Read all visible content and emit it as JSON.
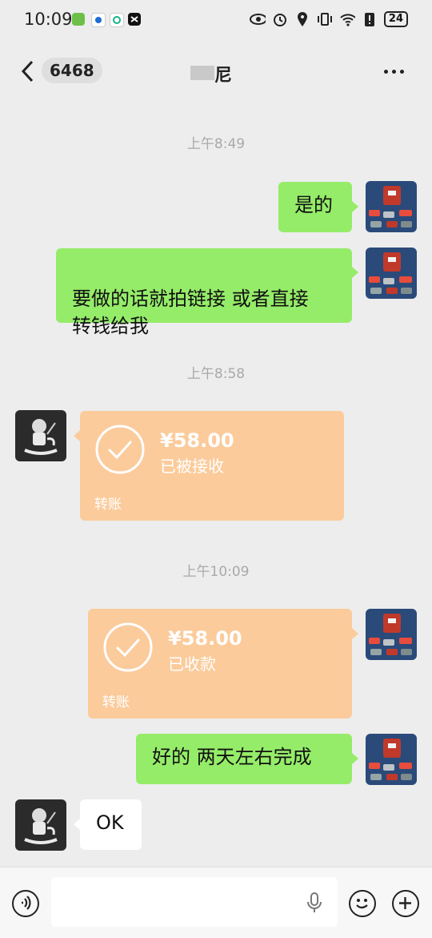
{
  "status_bar": {
    "time": "10:09",
    "battery": "24",
    "app_icons": [
      "green-app-icon",
      "blue-app-icon",
      "teal-app-icon",
      "capcut-icon"
    ],
    "system_icons": [
      "eye-icon",
      "alarm-icon",
      "location-icon",
      "vibrate-icon",
      "wifi-icon",
      "battery-alert-icon"
    ]
  },
  "nav": {
    "unread_count": "6468",
    "contact_name": "尼"
  },
  "messages": [
    {
      "type": "time",
      "text": "上午8:49"
    },
    {
      "type": "text",
      "side": "right",
      "text": "是的"
    },
    {
      "type": "text",
      "side": "right",
      "text": "要做的话就拍链接 或者直接\n转钱给我"
    },
    {
      "type": "time",
      "text": "上午8:58"
    },
    {
      "type": "transfer",
      "side": "left",
      "amount": "¥58.00",
      "status": "已被接收",
      "label": "转账"
    },
    {
      "type": "time",
      "text": "上午10:09"
    },
    {
      "type": "transfer",
      "side": "right",
      "amount": "¥58.00",
      "status": "已收款",
      "label": "转账"
    },
    {
      "type": "text",
      "side": "right",
      "text": "好的 两天左右完成"
    },
    {
      "type": "text",
      "side": "left",
      "text": "OK"
    }
  ],
  "input_bar": {
    "placeholder": "",
    "icons": [
      "voice-toggle-icon",
      "mic-icon",
      "emoji-icon",
      "plus-icon"
    ]
  },
  "colors": {
    "background": "#ededed",
    "bubble_green": "#95ec69",
    "transfer_orange": "#fbcb9b",
    "timestamp": "#a9a9a9"
  }
}
